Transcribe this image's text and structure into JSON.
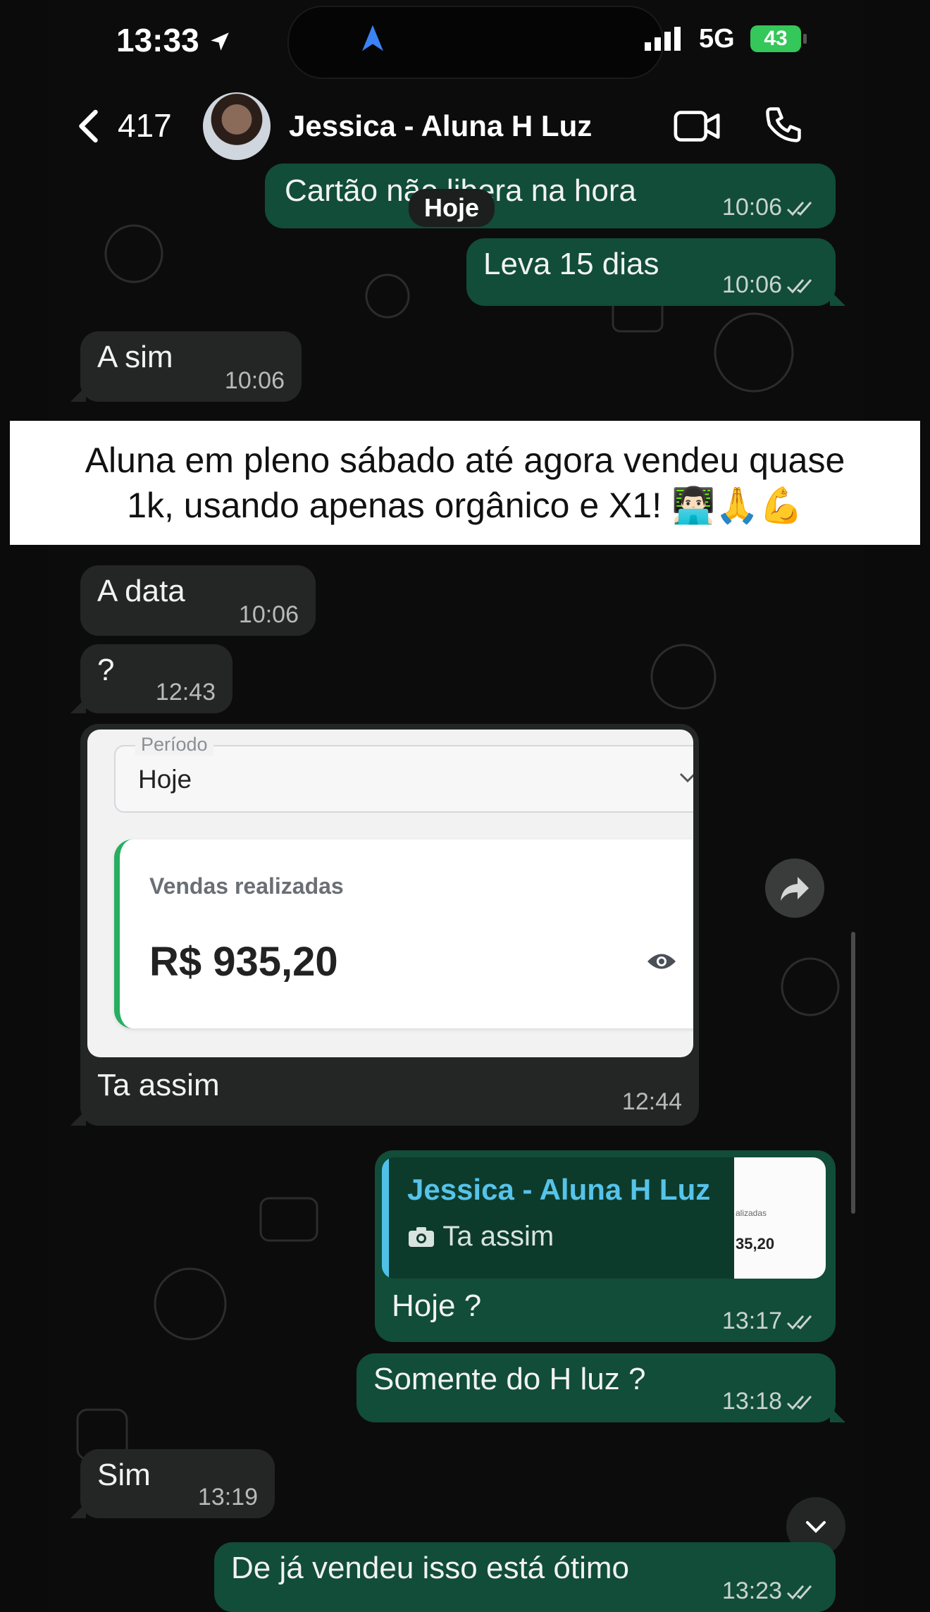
{
  "status_bar": {
    "time": "13:33",
    "network": "5G",
    "battery": "43"
  },
  "header": {
    "back_count": "417",
    "contact_name": "Jessica - Aluna H Luz"
  },
  "day_label": "Hoje",
  "messages": [
    {
      "text": "Cartão não libera na hora",
      "time": "10:06"
    },
    {
      "text": "Leva 15 dias",
      "time": "10:06"
    },
    {
      "text": "A sim",
      "time": "10:06"
    },
    {
      "text": "A data",
      "time": "10:06"
    },
    {
      "text": "?",
      "time": "12:43"
    },
    {
      "text": "Ta assim",
      "time": "12:44"
    },
    {
      "text": "Hoje ?",
      "time": "13:17"
    },
    {
      "text": "Somente do H luz ?",
      "time": "13:18"
    },
    {
      "text": "Sim",
      "time": "13:19"
    },
    {
      "text": "De já vendeu isso está ótimo",
      "time": "13:23"
    }
  ],
  "banner": {
    "line1": "Aluna em pleno sábado até agora vendeu quase",
    "line2": "1k, usando apenas orgânico e X1! 👨🏻‍💻🙏💪"
  },
  "image_message": {
    "field_label": "Período",
    "field_value": "Hoje",
    "card_label": "Vendas realizadas",
    "card_value": "R$ 935,20"
  },
  "reply": {
    "quoted_name": "Jessica - Aluna H Luz",
    "quoted_text": "Ta assim",
    "thumb_label": "alizadas",
    "thumb_value": "35,20"
  },
  "colors": {
    "outgoing_bubble": "#114d38",
    "incoming_bubble": "#242626",
    "quote_accent": "#4fc1e9"
  }
}
